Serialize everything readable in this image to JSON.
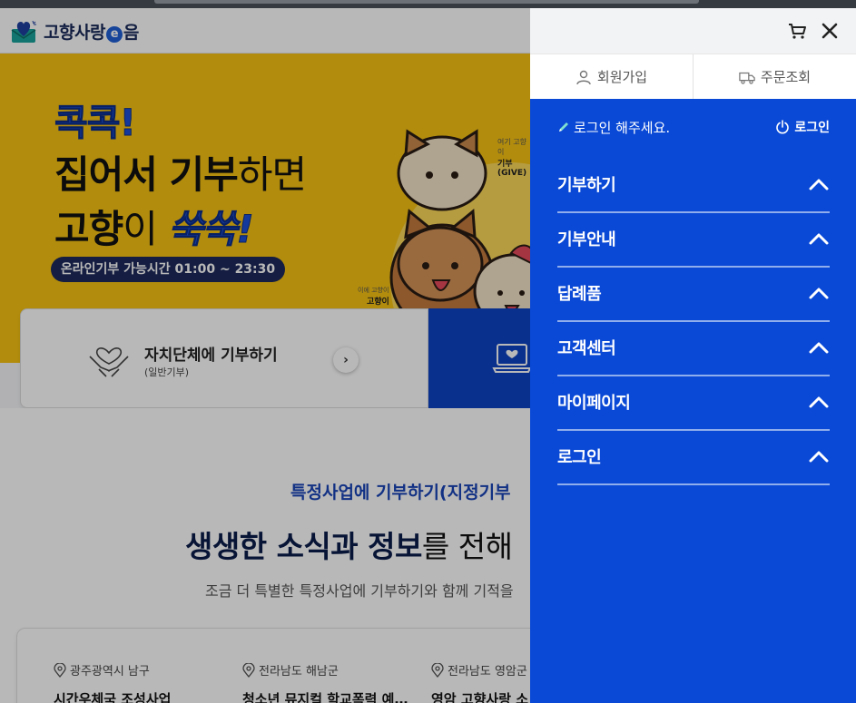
{
  "header": {
    "logo_text_a": "고향사랑",
    "logo_text_e": "e",
    "logo_text_b": "음"
  },
  "hero": {
    "line1": "콕콕!",
    "line2_bold": "집어서 기부",
    "line2_thin": "하면",
    "line3_bold": "고향",
    "line3_thin": "이 ",
    "line3_pop": "쑥쑥!",
    "pill": "온라인기부 가능시간 01:00 ~ 23:30",
    "cat_tag1_small": "여기 고향이",
    "cat_tag1": "기부(GIVE)",
    "cat_tag2_small": "이에 고향이",
    "cat_tag2": "고향이"
  },
  "quick": {
    "title": "자치단체에 기부하기",
    "sub": "(일반기부)"
  },
  "section": {
    "subtitle": "특정사업에 기부하기(지정기부",
    "title_bold": "생생한 소식과 정보",
    "title_rest": "를 전해",
    "desc": "조금 더 특별한 특정사업에 기부하기와 함께 기적을",
    "cards": [
      {
        "loc": "광주광역시 남구",
        "title": "시간우체국 조성사업"
      },
      {
        "loc": "전라남도 해남군",
        "title": "청소년 뮤지컬 학교폭력 예…"
      },
      {
        "loc": "전라남도 영암군",
        "title": "영암 고향사랑 소"
      }
    ]
  },
  "drawer": {
    "tabs": [
      "회원가입",
      "주문조회"
    ],
    "login_msg": "로그인 해주세요.",
    "login_link": "로그인",
    "menu": [
      "기부하기",
      "기부안내",
      "답례품",
      "고객센터",
      "마이페이지",
      "로그인"
    ]
  },
  "colors": {
    "drawer_blue": "#0a49d6",
    "hero_yellow": "#f7c312",
    "brand_navy": "#1a2a5a"
  }
}
